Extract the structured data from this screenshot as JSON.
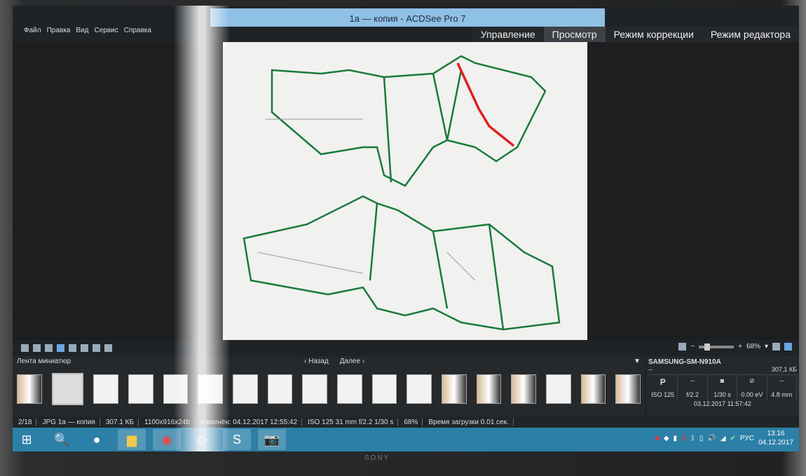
{
  "window": {
    "title": "1а — копия - ACDSee Pro 7"
  },
  "menu": [
    "Файл",
    "Правка",
    "Вид",
    "Сервис",
    "Справка"
  ],
  "modes": [
    {
      "label": "Управление",
      "active": false
    },
    {
      "label": "Просмотр",
      "active": true
    },
    {
      "label": "Режим коррекции",
      "active": false
    },
    {
      "label": "Режим редактора",
      "active": false
    }
  ],
  "viewbar": {
    "zoom": "68%"
  },
  "strip": {
    "title": "Лента миниатюр",
    "back": "‹ Назад",
    "next": "Далее ›",
    "thumb_count": 18,
    "selected_index": 1
  },
  "info": {
    "camera": "SAMSUNG-SM-N910A",
    "subtitle": "--",
    "size": "307,1 КБ",
    "row1": [
      "P",
      "--",
      "◙",
      "⊘",
      "--"
    ],
    "row2": [
      "ISO 125",
      "f/2.2",
      "1/30 s",
      "0.00 eV",
      "4.8 mm"
    ],
    "date": "03.12.2017 11:57:42"
  },
  "status": [
    "2/18",
    "JPG 1а — копия",
    "307.1 КБ",
    "1100x916x24b",
    "Изменён: 04.12.2017 12:55:42",
    "ISO 125  31 mm  f/2.2  1/30 s",
    "68%",
    "Время загрузки 0.01 сек."
  ],
  "taskbar": {
    "lang": "РУС",
    "time": "13:16",
    "date": "04.12.2017"
  },
  "monitor_brand": "SONY",
  "colors": {
    "title": "#8fc0e6",
    "taskbar": "#2c7fa6",
    "pattern": "#1a7a3a",
    "highlight": "#e02020"
  }
}
